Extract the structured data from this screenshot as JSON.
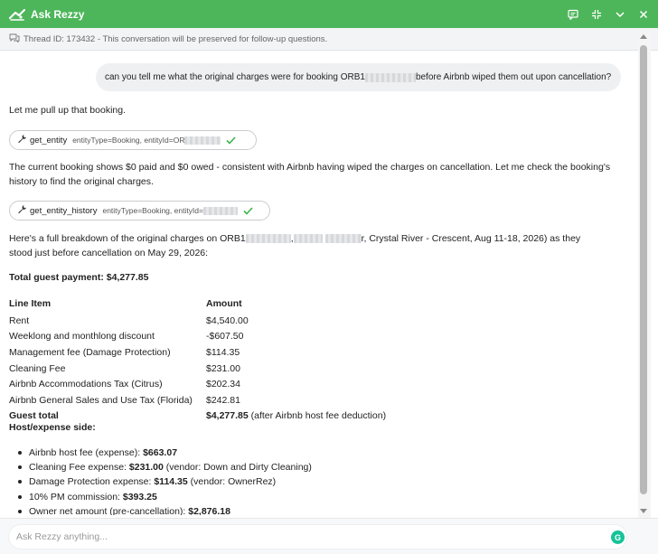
{
  "app": {
    "title": "Ask Rezzy",
    "accent": "#4db65a"
  },
  "thread": {
    "text": "Thread ID: 173432 - This conversation will be preserved for follow-up questions."
  },
  "user_message": {
    "prefix": "can you tell me what the original charges were for booking ORB1",
    "suffix": "before Airbnb wiped them out upon cancellation?"
  },
  "assistant": {
    "p1": "Let me pull up that booking.",
    "tool1": {
      "name": "get_entity",
      "args": "entityType=Booking, entityId=OR"
    },
    "p2": "The current booking shows $0 paid and $0 owed - consistent with Airbnb having wiped the charges on cancellation. Let me check the booking's history to find the original charges.",
    "tool2": {
      "name": "get_entity_history",
      "args": "entityType=Booking, entityId="
    },
    "p3_prefix": "Here's a full breakdown of the original charges on ORB1",
    "p3_mid": ",",
    "p3_suffix": "r, Crystal River - Crescent, Aug 11-18, 2026) as they",
    "p3_line2": "stood just before cancellation on May 29, 2026:",
    "total_label": "Total guest payment: $4,277.85",
    "table": {
      "headers": [
        "Line Item",
        "Amount"
      ],
      "rows": [
        [
          "Rent",
          "$4,540.00"
        ],
        [
          "Weeklong and monthlong discount",
          "-$607.50"
        ],
        [
          "Management fee (Damage Protection)",
          "$114.35"
        ],
        [
          "Cleaning Fee",
          "$231.00"
        ],
        [
          "Airbnb Accommodations Tax (Citrus)",
          "$202.34"
        ],
        [
          "Airbnb General Sales and Use Tax (Florida)",
          "$242.81"
        ]
      ],
      "guest_total_label": "Guest total",
      "guest_total_value": "$4,277.85",
      "guest_total_note": "(after Airbnb host fee deduction)"
    },
    "host_heading": "Host/expense side:",
    "host_items": [
      {
        "label": "Airbnb host fee (expense): ",
        "value": "$663.07",
        "note": ""
      },
      {
        "label": "Cleaning Fee expense: ",
        "value": "$231.00",
        "note": " (vendor: Down and Dirty Cleaning)"
      },
      {
        "label": "Damage Protection expense: ",
        "value": "$114.35",
        "note": " (vendor: OwnerRez)"
      },
      {
        "label": "10% PM commission: ",
        "value": "$393.25",
        "note": ""
      },
      {
        "label": "Owner net amount (pre-cancellation): ",
        "value": "$2,876.18",
        "note": ""
      }
    ]
  },
  "input": {
    "placeholder": "Ask Rezzy anything..."
  }
}
